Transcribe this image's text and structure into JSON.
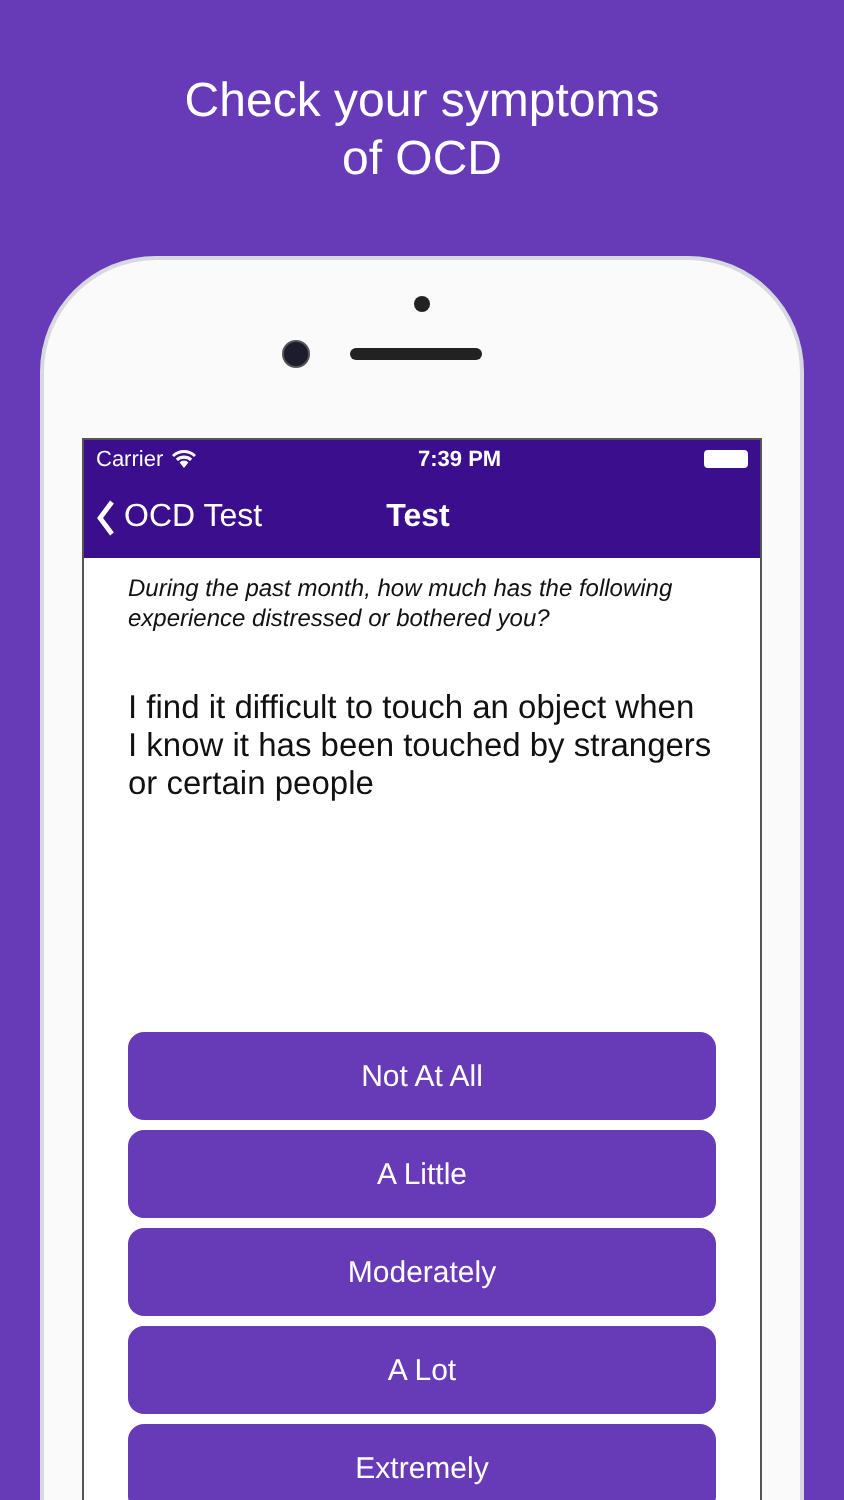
{
  "headline": "Check your symptoms of OCD",
  "status_bar": {
    "carrier": "Carrier",
    "time": "7:39 PM"
  },
  "nav": {
    "back": "OCD Test",
    "title": "Test"
  },
  "instruction": "During the past month, how much has the following experience distressed or bothered you?",
  "statement": "I find it difficult to touch an object when I know it has been touched by strangers or certain people",
  "answers": [
    "Not At All",
    "A Little",
    "Moderately",
    "A Lot",
    "Extremely"
  ]
}
